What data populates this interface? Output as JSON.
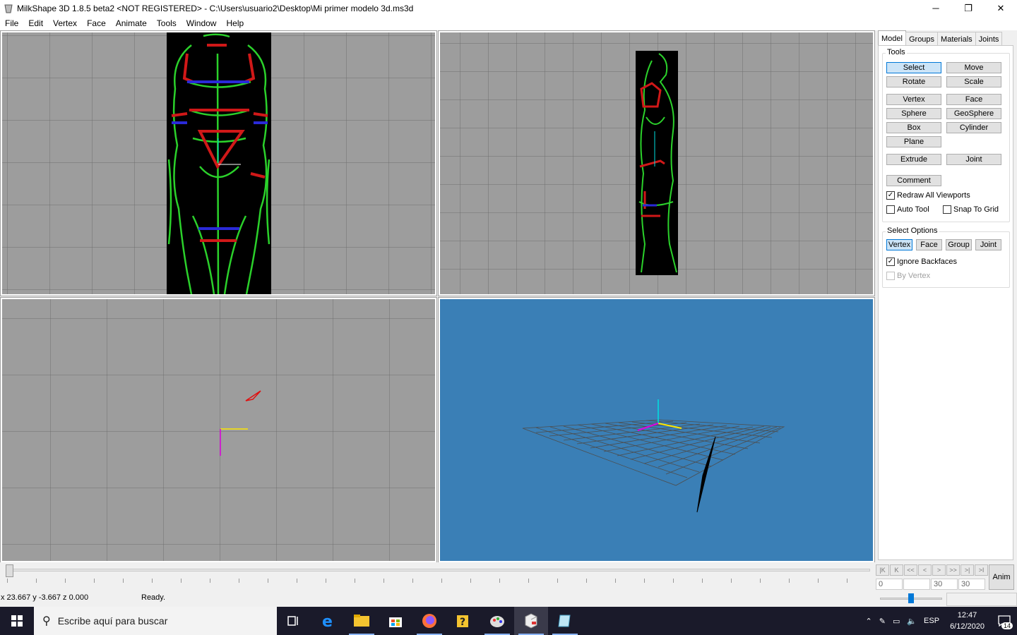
{
  "window": {
    "title": "MilkShape 3D 1.8.5 beta2 <NOT REGISTERED> - C:\\Users\\usuario2\\Desktop\\Mi primer modelo 3d.ms3d",
    "minimize": "─",
    "restore": "❐",
    "close": "✕"
  },
  "menu": [
    "File",
    "Edit",
    "Vertex",
    "Face",
    "Animate",
    "Tools",
    "Window",
    "Help"
  ],
  "panel": {
    "tabs": [
      "Model",
      "Groups",
      "Materials",
      "Joints"
    ],
    "active_tab": "Model",
    "tools_label": "Tools",
    "tools": {
      "select": "Select",
      "move": "Move",
      "rotate": "Rotate",
      "scale": "Scale",
      "vertex": "Vertex",
      "face": "Face",
      "sphere": "Sphere",
      "geosphere": "GeoSphere",
      "box": "Box",
      "cylinder": "Cylinder",
      "plane": "Plane",
      "extrude": "Extrude",
      "joint": "Joint",
      "comment": "Comment"
    },
    "checks": {
      "redraw": "Redraw All Viewports",
      "auto_tool": "Auto Tool",
      "snap": "Snap To Grid"
    },
    "select_options_label": "Select Options",
    "select_options": {
      "vertex": "Vertex",
      "face": "Face",
      "group": "Group",
      "joint": "Joint"
    },
    "ignore_backfaces": "Ignore Backfaces",
    "by_vertex": "By Vertex"
  },
  "animation": {
    "buttons": [
      "|K",
      "K",
      "<<",
      "<",
      ">",
      ">>",
      ">|",
      ">I"
    ],
    "start_frame": "0",
    "current_frame": "",
    "end_frame": "30",
    "total_frames": "30",
    "anim_label": "Anim"
  },
  "status": {
    "coords": "x 23.667 y -3.667 z 0.000",
    "message": "Ready."
  },
  "taskbar": {
    "search_placeholder": "Escribe aquí para buscar",
    "lang": "ESP",
    "time": "12:47",
    "date": "6/12/2020",
    "notifications": "14"
  }
}
